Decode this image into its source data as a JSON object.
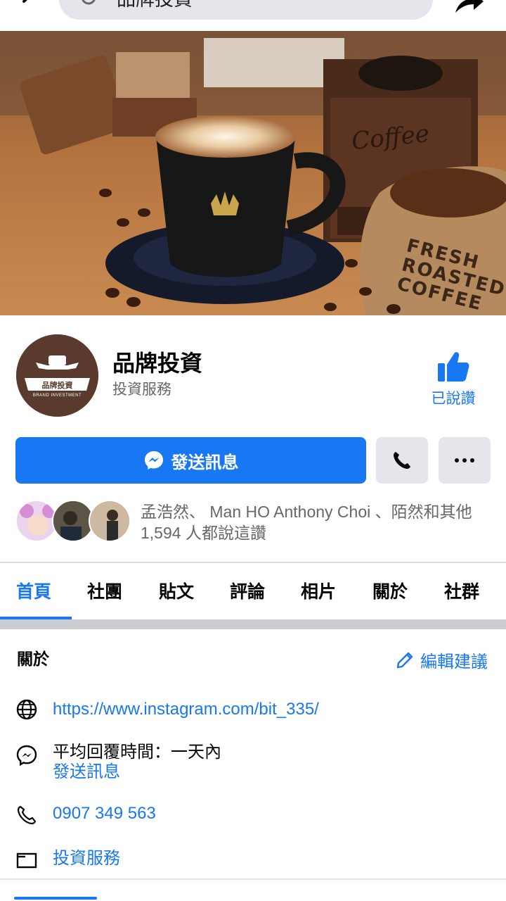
{
  "search": {
    "query": "品牌投資"
  },
  "page": {
    "name": "品牌投資",
    "category": "投資服務",
    "liked_label": "已說讚",
    "avatar_text": "品牌投資",
    "avatar_subtext": "BRAND INVESTMENT"
  },
  "cover": {
    "grinder_text": "Coffee",
    "sack_lines": [
      "FRESH",
      "ROASTED",
      "COFFEE"
    ]
  },
  "actions": {
    "send_message_label": "發送訊息",
    "call_icon": "phone-icon",
    "more_icon": "more-icon"
  },
  "likers": {
    "text": "孟浩然、 Man HO Anthony Choi 、陌然和其他 1,594 人都說這讚"
  },
  "tabs": [
    {
      "label": "首頁",
      "active": true
    },
    {
      "label": "社團"
    },
    {
      "label": "貼文"
    },
    {
      "label": "評論"
    },
    {
      "label": "相片"
    },
    {
      "label": "關於"
    },
    {
      "label": "社群"
    }
  ],
  "about": {
    "title": "關於",
    "edit_label": "編輯建議",
    "website": "https://www.instagram.com/bit_335/",
    "response_time": "平均回覆時間：一天內",
    "send_message": "發送訊息",
    "phone": "0907 349 563",
    "category": "投資服務"
  },
  "colors": {
    "accent": "#1877f2",
    "button_gray": "#e4e6eb",
    "secondary_text": "#65676b"
  }
}
